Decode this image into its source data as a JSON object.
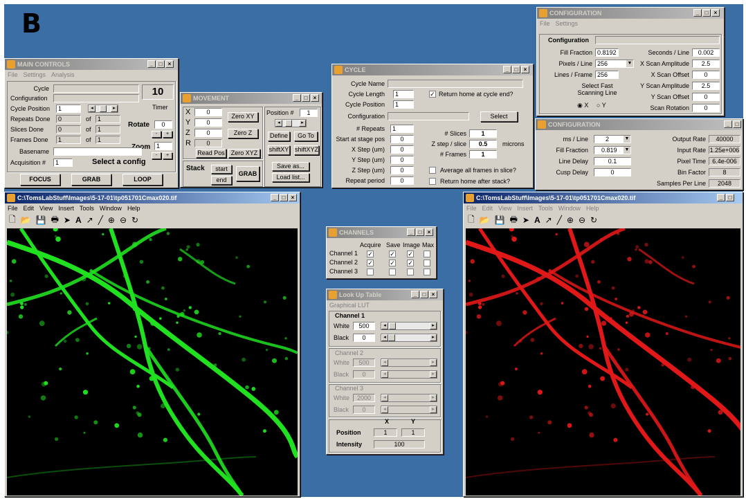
{
  "panel_label": "B",
  "main_controls": {
    "title": "MAIN CONTROLS",
    "menu": [
      "File",
      "Settings",
      "Analysis"
    ],
    "cycle_label": "Cycle",
    "configuration_label": "Configuration",
    "timer_value": "10",
    "timer_label": "Timer",
    "cycle_position_label": "Cycle Position",
    "cycle_position_value": "1",
    "repeats_done_label": "Repeats Done",
    "repeats_done_value": "0",
    "repeats_total": "1",
    "slices_done_label": "Slices Done",
    "slices_done_value": "0",
    "slices_total": "1",
    "frames_done_label": "Frames Done",
    "frames_done_value": "1",
    "frames_total": "1",
    "of_label": "of",
    "rotate_label": "Rotate",
    "rotate_value": "0",
    "zoom_label": "Zoom",
    "zoom_value": "1",
    "basename_label": "Basename",
    "acquisition_label": "Acquisition #",
    "acquisition_value": "1",
    "status": "Select a config",
    "focus_btn": "FOCUS",
    "grab_btn": "GRAB",
    "loop_btn": "LOOP"
  },
  "movement": {
    "title": "MOVEMENT",
    "x_label": "X",
    "y_label": "Y",
    "z_label": "Z",
    "r_label": "R",
    "x_value": "0",
    "y_value": "0",
    "z_value": "0",
    "r_value": "0",
    "zero_xy": "Zero XY",
    "zero_z": "Zero Z",
    "read_pos": "Read Pos",
    "zero_xyz": "Zero XYZ",
    "position_label": "Position #",
    "position_value": "1",
    "define": "Define",
    "go_to": "Go To",
    "shift_xy": "shiftXY",
    "shift_xyz": "shiftXYZ",
    "save_as": "Save as...",
    "load_list": "Load list...",
    "stack_label": "Stack",
    "start": "start",
    "end": "end",
    "grab": "GRAB"
  },
  "cycle": {
    "title": "CYCLE",
    "cycle_name_label": "Cycle Name",
    "cycle_length_label": "Cycle Length",
    "cycle_length_value": "1",
    "cycle_position_label": "Cycle Position",
    "cycle_position_value": "1",
    "configuration_label": "Configuration",
    "return_home_label": "Return home at cycle end?",
    "select_btn": "Select",
    "repeats_label": "# Repeats",
    "repeats_value": "1",
    "start_stage_label": "Start at stage pos",
    "start_stage_value": "0",
    "x_step_label": "X Step (um)",
    "x_step_value": "0",
    "y_step_label": "Y Step (um)",
    "y_step_value": "0",
    "z_step_label": "Z Step (um)",
    "z_step_value": "0",
    "repeat_period_label": "Repeat period",
    "repeat_period_value": "0",
    "slices_label": "# Slices",
    "slices_value": "1",
    "zstep_slice_label": "Z step / slice",
    "zstep_slice_value": "0.5",
    "microns_label": "microns",
    "frames_label": "# Frames",
    "frames_value": "1",
    "average_label": "Average all frames in slice?",
    "return_stack_label": "Return home after stack?"
  },
  "config1": {
    "title": "CONFIGURATION",
    "menu": [
      "File",
      "Settings"
    ],
    "configuration_label": "Configuration",
    "fill_fraction_label": "Fill Fraction",
    "fill_fraction_value": "0.8192",
    "seconds_line_label": "Seconds / Line",
    "seconds_line_value": "0.002",
    "pixels_line_label": "Pixels / Line",
    "pixels_line_value": "256",
    "x_amp_label": "X Scan Amplitude",
    "x_amp_value": "2.5",
    "lines_frame_label": "Lines / Frame",
    "lines_frame_value": "256",
    "x_offset_label": "X Scan Offset",
    "x_offset_value": "0",
    "select_fast_label1": "Select Fast",
    "select_fast_label2": "Scanning Line",
    "y_amp_label": "Y Scan Amplitude",
    "y_amp_value": "2.5",
    "y_offset_label": "Y Scan Offset",
    "y_offset_value": "0",
    "x_radio": "X",
    "y_radio": "Y",
    "scan_rotation_label": "Scan Rotation",
    "scan_rotation_value": "0"
  },
  "config2": {
    "title": "CONFIGURATION",
    "ms_line_label": "ms / Line",
    "ms_line_value": "2",
    "output_rate_label": "Output Rate",
    "output_rate_value": "40000",
    "fill_fraction_label": "Fill Fraction",
    "fill_fraction_value": "0.819",
    "input_rate_label": "Input Rate",
    "input_rate_value": "1.25e+006",
    "line_delay_label": "Line Delay",
    "line_delay_value": "0.1",
    "pixel_time_label": "Pixel Time",
    "pixel_time_value": "6.4e-006",
    "cusp_delay_label": "Cusp Delay",
    "cusp_delay_value": "0",
    "bin_factor_label": "Bin Factor",
    "bin_factor_value": "8",
    "samples_line_label": "Samples Per Line",
    "samples_line_value": "2048"
  },
  "image_left": {
    "title": "C:\\TomsLabStuff\\Images\\5-17-01\\tp051701Cmax020.tif",
    "menu": [
      "File",
      "Edit",
      "View",
      "Insert",
      "Tools",
      "Window",
      "Help"
    ],
    "color": "#20e020"
  },
  "image_right": {
    "title": "C:\\TomsLabStuff\\Images\\5-17-01\\tp051701Cmax020.tif",
    "menu": [
      "File",
      "Edit",
      "View",
      "Insert",
      "Tools",
      "Window",
      "Help"
    ],
    "color": "#e01818"
  },
  "toolbar_icons": [
    "new-icon",
    "open-icon",
    "save-icon",
    "print-icon",
    "arrow-icon",
    "text-icon",
    "line-arrow-icon",
    "line-icon",
    "zoom-in-icon",
    "zoom-out-icon",
    "rotate-icon"
  ],
  "channels": {
    "title": "CHANNELS",
    "headers": [
      "Acquire",
      "Save",
      "Image",
      "Max"
    ],
    "rows": [
      {
        "label": "Channel 1",
        "checks": [
          true,
          true,
          true,
          false
        ]
      },
      {
        "label": "Channel 2",
        "checks": [
          true,
          true,
          true,
          false
        ]
      },
      {
        "label": "Channel 3",
        "checks": [
          false,
          false,
          false,
          false
        ]
      }
    ]
  },
  "lut": {
    "title": "Look Up Table",
    "menu": [
      "Graphical LUT"
    ],
    "ch1_label": "Channel 1",
    "ch2_label": "Channel 2",
    "ch3_label": "Channel 3",
    "white_label": "White",
    "black_label": "Black",
    "ch1_white": "500",
    "ch1_black": "0",
    "ch2_white": "500",
    "ch2_black": "0",
    "ch3_white": "2000",
    "ch3_black": "0",
    "x_header": "X",
    "y_header": "Y",
    "position_label": "Position",
    "position_x": "1",
    "position_y": "1",
    "intensity_label": "Intensity",
    "intensity_value": "100"
  }
}
